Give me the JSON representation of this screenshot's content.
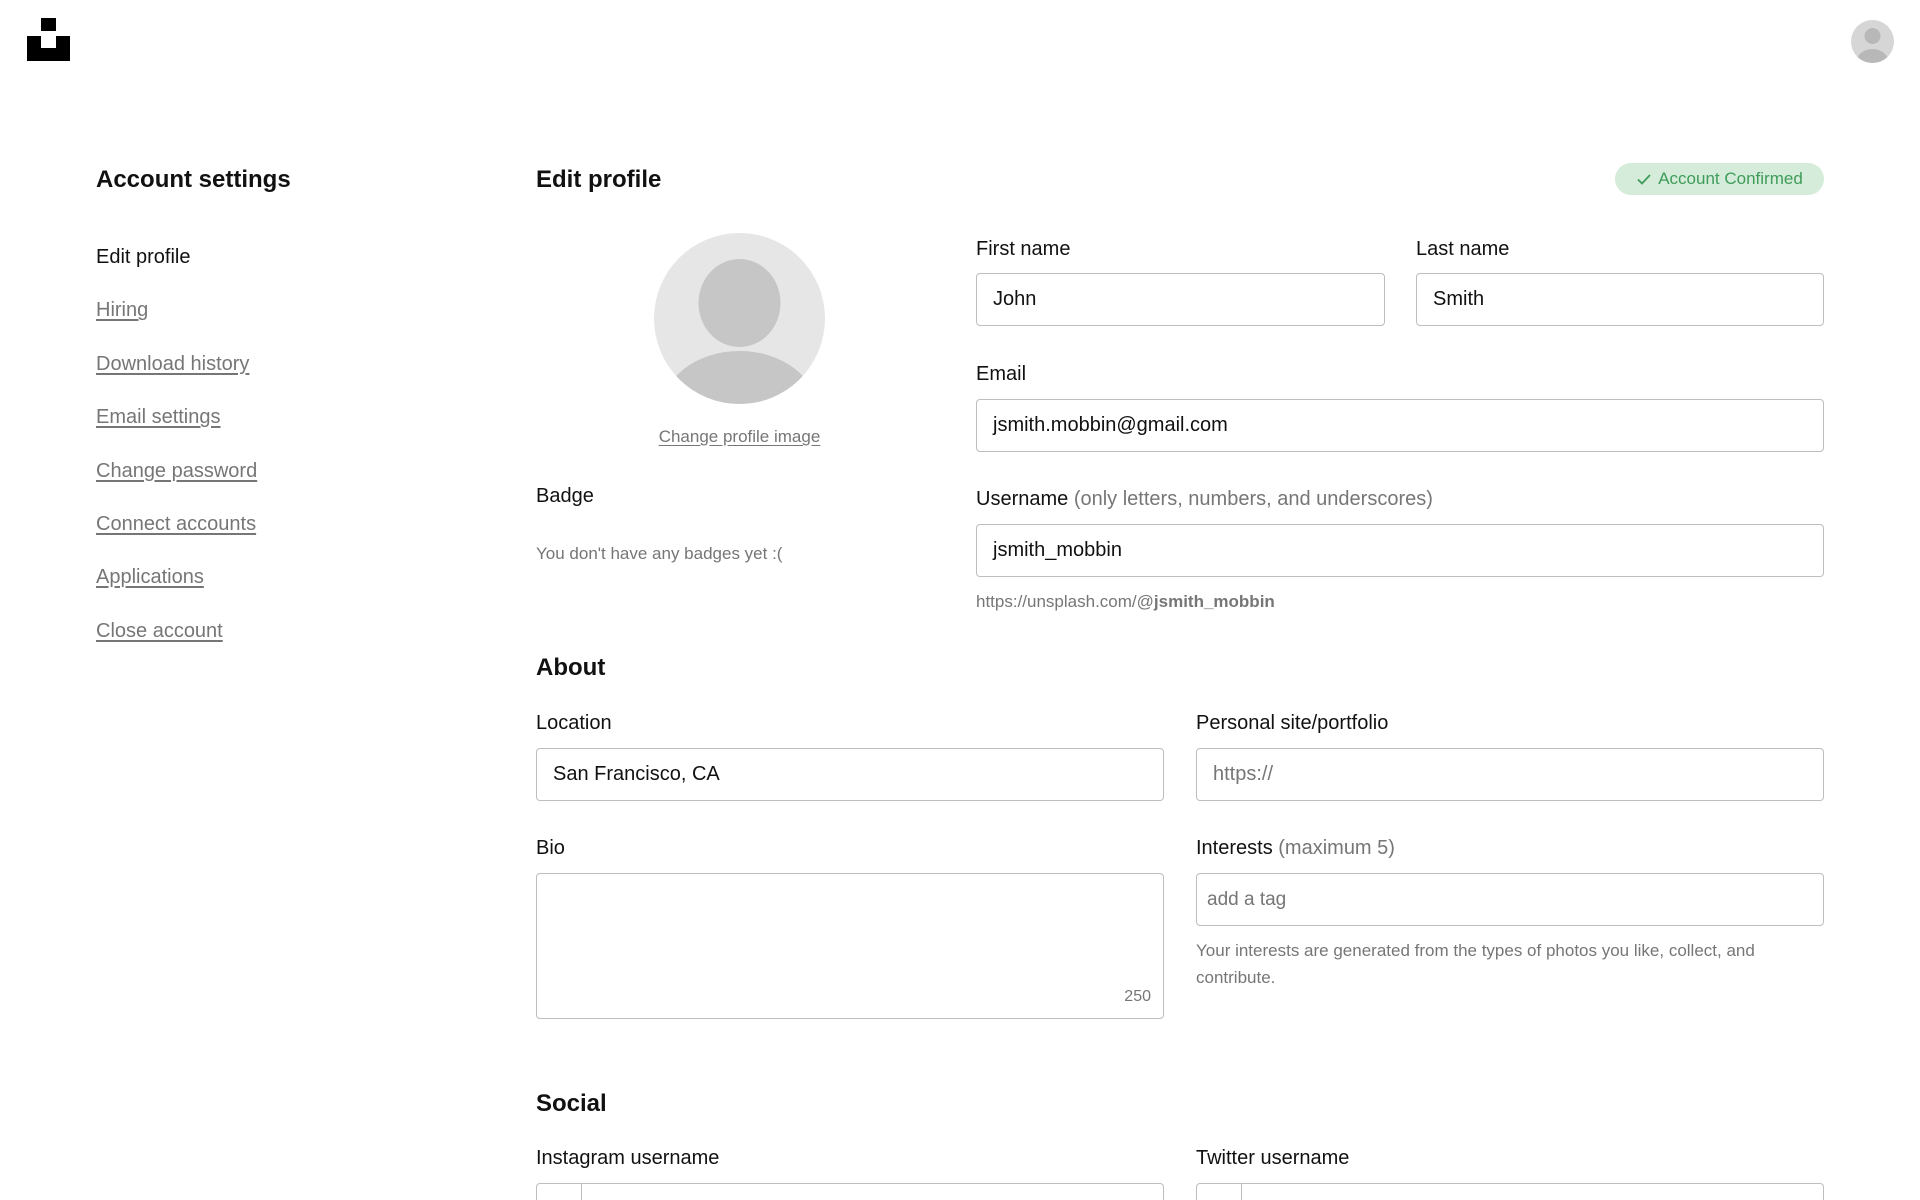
{
  "header": {
    "logo_icon": "unsplash-logo-icon",
    "avatar_icon": "user-avatar-icon"
  },
  "sidebar": {
    "title": "Account settings",
    "items": [
      {
        "label": "Edit profile",
        "active": true
      },
      {
        "label": "Hiring"
      },
      {
        "label": "Download history"
      },
      {
        "label": "Email settings"
      },
      {
        "label": "Change password"
      },
      {
        "label": "Connect accounts"
      },
      {
        "label": "Applications"
      },
      {
        "label": "Close account"
      }
    ]
  },
  "main": {
    "title": "Edit profile",
    "status_badge": "Account Confirmed",
    "change_image_label": "Change profile image",
    "badge": {
      "label": "Badge",
      "empty_text": "You don't have any badges yet :("
    },
    "first_name": {
      "label": "First name",
      "value": "John"
    },
    "last_name": {
      "label": "Last name",
      "value": "Smith"
    },
    "email": {
      "label": "Email",
      "value": "jsmith.mobbin@gmail.com"
    },
    "username": {
      "label": "Username",
      "hint": "(only letters, numbers, and underscores)",
      "value": "jsmith_mobbin",
      "url_prefix": "https://unsplash.com/@",
      "url_handle": "jsmith_mobbin"
    }
  },
  "about": {
    "title": "About",
    "location": {
      "label": "Location",
      "value": "San Francisco, CA"
    },
    "personal_site": {
      "label": "Personal site/portfolio",
      "placeholder": "https://"
    },
    "bio": {
      "label": "Bio",
      "counter": "250"
    },
    "interests": {
      "label": "Interests",
      "hint": "(maximum 5)",
      "placeholder": "add a tag",
      "help": "Your interests are generated from the types of photos you like, collect, and contribute."
    }
  },
  "social": {
    "title": "Social",
    "instagram": {
      "label": "Instagram username"
    },
    "twitter": {
      "label": "Twitter username"
    }
  },
  "colors": {
    "badge_bg": "#d4ecd9",
    "badge_text": "#3f9c5a",
    "muted_text": "#767676",
    "field_border": "#bdbdbd"
  }
}
